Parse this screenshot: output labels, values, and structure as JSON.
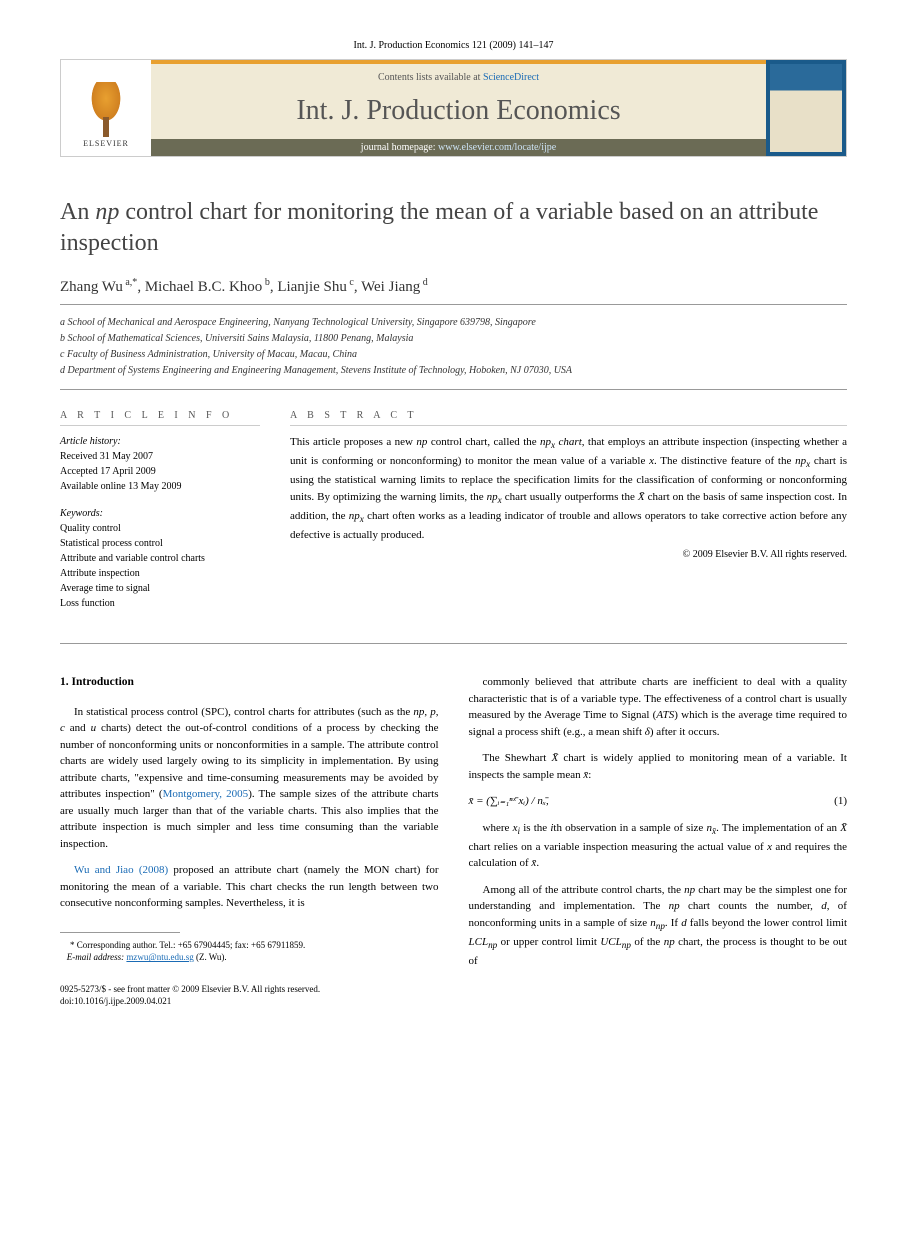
{
  "header": {
    "citation": "Int. J. Production Economics 121 (2009) 141–147"
  },
  "masthead": {
    "contents_prefix": "Contents lists available at ",
    "contents_link": "ScienceDirect",
    "journal_name": "Int. J. Production Economics",
    "homepage_prefix": "journal homepage: ",
    "homepage_url": "www.elsevier.com/locate/ijpe",
    "publisher": "ELSEVIER"
  },
  "title": {
    "html": "An <em>np</em> control chart for monitoring the mean of a variable based on an attribute inspection"
  },
  "authors_line": "Zhang Wu a,*, Michael B.C. Khoo b, Lianjie Shu c, Wei Jiang d",
  "affiliations": {
    "a": "a School of Mechanical and Aerospace Engineering, Nanyang Technological University, Singapore 639798, Singapore",
    "b": "b School of Mathematical Sciences, Universiti Sains Malaysia, 11800 Penang, Malaysia",
    "c": "c Faculty of Business Administration, University of Macau, Macau, China",
    "d": "d Department of Systems Engineering and Engineering Management, Stevens Institute of Technology, Hoboken, NJ 07030, USA"
  },
  "article_info": {
    "label": "A R T I C L E  I N F O",
    "history_label": "Article history:",
    "received": "Received 31 May 2007",
    "accepted": "Accepted 17 April 2009",
    "online": "Available online 13 May 2009",
    "keywords_label": "Keywords:",
    "keywords": [
      "Quality control",
      "Statistical process control",
      "Attribute and variable control charts",
      "Attribute inspection",
      "Average time to signal",
      "Loss function"
    ]
  },
  "abstract": {
    "label": "A B S T R A C T",
    "text_html": "This article proposes a new <em>np</em> control chart, called the <em>np<sub>x</sub> chart</em>, that employs an attribute inspection (inspecting whether a unit is conforming or nonconforming) to monitor the mean value of a variable <em>x</em>. The distinctive feature of the <em>np<sub>x</sub></em> chart is using the statistical warning limits to replace the specification limits for the classification of conforming or nonconforming units. By optimizing the warning limits, the <em>np<sub>x</sub></em> chart usually outperforms the <em>X̄</em> chart on the basis of same inspection cost. In addition, the <em>np<sub>x</sub></em> chart often works as a leading indicator of trouble and allows operators to take corrective action before any defective is actually produced.",
    "copyright": "© 2009 Elsevier B.V. All rights reserved."
  },
  "body": {
    "section1_heading": "1. Introduction",
    "col1_p1_html": "In statistical process control (SPC), control charts for attributes (such as the <em>np</em>, <em>p</em>, <em>c</em> and <em>u</em> charts) detect the out-of-control conditions of a process by checking the number of nonconforming units or nonconformities in a sample. The attribute control charts are widely used largely owing to its simplicity in implementation. By using attribute charts, \"expensive and time-consuming measurements may be avoided by attributes inspection\" (<span class=\"ref-link\">Montgomery, 2005</span>). The sample sizes of the attribute charts are usually much larger than that of the variable charts. This also implies that the attribute inspection is much simpler and less time consuming than the variable inspection.",
    "col1_p2_html": "<span class=\"ref-link\">Wu and Jiao (2008)</span> proposed an attribute chart (namely the MON chart) for monitoring the mean of a variable. This chart checks the run length between two consecutive nonconforming samples. Nevertheless, it is",
    "col2_p1_html": "commonly believed that attribute charts are inefficient to deal with a quality characteristic that is of a variable type. The effectiveness of a control chart is usually measured by the Average Time to Signal (<em>ATS</em>) which is the average time required to signal a process shift (e.g., a mean shift <em>δ</em>) after it occurs.",
    "col2_p2_html": "The Shewhart <em>X̄</em> chart is widely applied to monitoring mean of a variable. It inspects the sample mean <em>x̄</em>:",
    "equation": "x̄ = (∑ᵢ₌₁ⁿˣ̄ xᵢ) / nₓ̄,",
    "eq_num": "(1)",
    "col2_p3_html": "where <em>x<sub>i</sub></em> is the <em>i</em>th observation in a sample of size <em>n<sub>x̄</sub></em>. The implementation of an <em>X̄</em> chart relies on a variable inspection measuring the actual value of <em>x</em> and requires the calculation of <em>x̄</em>.",
    "col2_p4_html": "Among all of the attribute control charts, the <em>np</em> chart may be the simplest one for understanding and implementation. The <em>np</em> chart counts the number, <em>d</em>, of nonconforming units in a sample of size <em>n<sub>np</sub></em>. If <em>d</em> falls beyond the lower control limit <em>LCL<sub>np</sub></em> or upper control limit <em>UCL<sub>np</sub></em> of the <em>np</em> chart, the process is thought to be out of"
  },
  "footnote": {
    "corr": "* Corresponding author. Tel.: +65 67904445; fax: +65 67911859.",
    "email_label": "E-mail address:",
    "email": "mzwu@ntu.edu.sg",
    "email_suffix": "(Z. Wu)."
  },
  "footer": {
    "issn_line": "0925-5273/$ - see front matter © 2009 Elsevier B.V. All rights reserved.",
    "doi_line": "doi:10.1016/j.ijpe.2009.04.021"
  }
}
